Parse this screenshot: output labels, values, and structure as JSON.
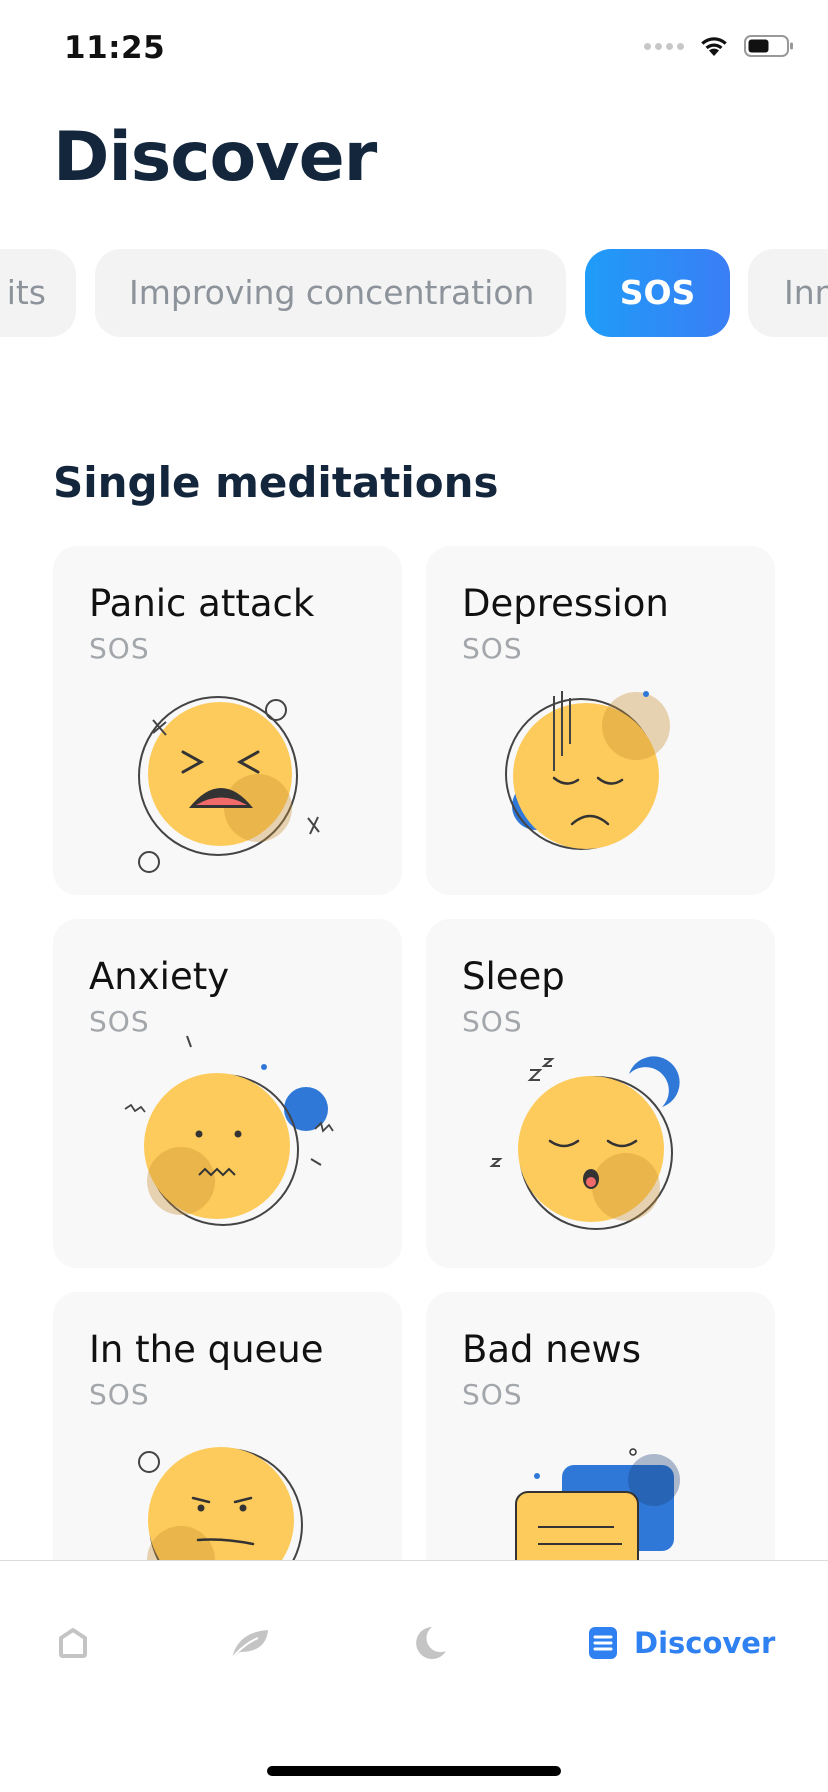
{
  "status_bar": {
    "time": "11:25"
  },
  "header": {
    "title": "Discover"
  },
  "chips": [
    {
      "label": "its",
      "active": false
    },
    {
      "label": "Improving concentration",
      "active": false
    },
    {
      "label": "SOS",
      "active": true
    },
    {
      "label": "Inn",
      "active": false
    }
  ],
  "section": {
    "title": "Single meditations"
  },
  "cards": [
    {
      "title": "Panic attack",
      "subtitle": "SOS"
    },
    {
      "title": "Depression",
      "subtitle": "SOS"
    },
    {
      "title": "Anxiety",
      "subtitle": "SOS"
    },
    {
      "title": "Sleep",
      "subtitle": "SOS"
    },
    {
      "title": "In the queue",
      "subtitle": "SOS"
    },
    {
      "title": "Bad news",
      "subtitle": "SOS"
    }
  ],
  "tab_bar": {
    "tabs": [
      {
        "icon": "home-icon",
        "label": "",
        "active": false
      },
      {
        "icon": "leaf-icon",
        "label": "",
        "active": false
      },
      {
        "icon": "moon-icon",
        "label": "",
        "active": false
      },
      {
        "icon": "discover-icon",
        "label": "Discover",
        "active": true
      }
    ]
  },
  "colors": {
    "accent": "#2f80f0",
    "chip_active_start": "#1f9cf8",
    "chip_active_end": "#3a7ef5",
    "emoji_yellow": "#fdcb5c",
    "title_dark": "#13263b"
  }
}
